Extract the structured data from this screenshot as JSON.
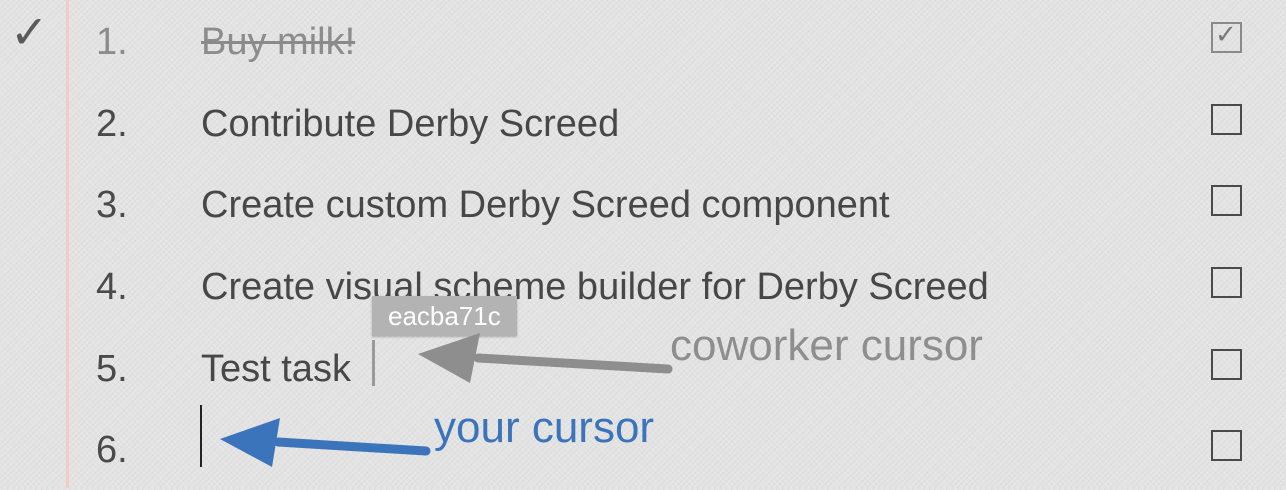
{
  "todo": {
    "items": [
      {
        "number": "1.",
        "text": "Buy milk!",
        "done": true
      },
      {
        "number": "2.",
        "text": "Contribute Derby Screed",
        "done": false
      },
      {
        "number": "3.",
        "text": "Create custom Derby Screed component",
        "done": false
      },
      {
        "number": "4.",
        "text": "Create visual scheme builder for Derby Screed",
        "done": false
      },
      {
        "number": "5.",
        "text": "Test task",
        "done": false
      },
      {
        "number": "6.",
        "text": "",
        "done": false
      }
    ],
    "done_mark": "✓",
    "checked_box_glyph": "✓"
  },
  "cursors": {
    "coworker_tag": "eacba71c",
    "coworker_label": "coworker cursor",
    "your_label": "your cursor"
  },
  "colors": {
    "coworker": "#8e8e8e",
    "you": "#3b74ba",
    "margin_line": "#f3c9c6"
  }
}
